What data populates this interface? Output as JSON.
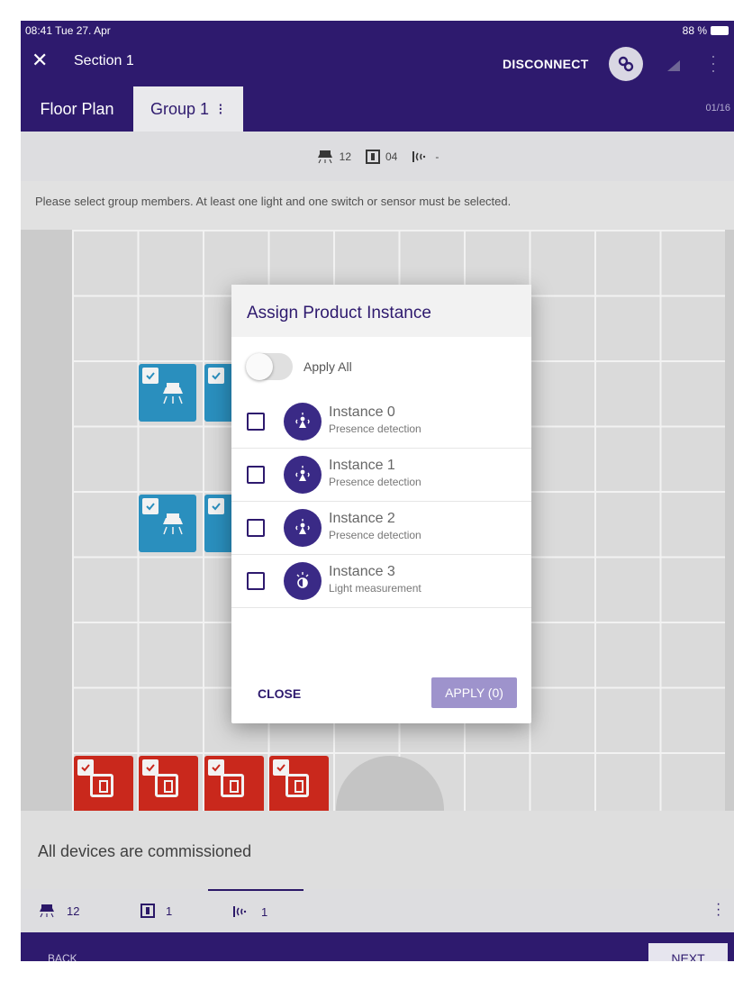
{
  "status_bar": {
    "time": "08:41  Tue 27. Apr",
    "battery": "88 %"
  },
  "app_bar": {
    "close_glyph": "✕",
    "title": "Section 1",
    "disconnect_label": "DISCONNECT",
    "link_icon": "link-icon",
    "signal_icon": "signal-icon"
  },
  "tabs": {
    "floor_plan": "Floor Plan",
    "group": "Group 1",
    "pager": "01/16"
  },
  "counts": {
    "lights": "12",
    "switches": "04",
    "sensors": "-"
  },
  "instruction": "Please select group members. At least one light and one switch or sensor must be selected.",
  "status_message": "All devices are commissioned",
  "bottom_tabs": {
    "lights": "12",
    "switches": "1",
    "sensors": "1"
  },
  "footer": {
    "back": "BACK",
    "next": "NEXT"
  },
  "dialog": {
    "title": "Assign Product Instance",
    "apply_all_label": "Apply All",
    "instances": [
      {
        "name": "Instance 0",
        "type": "Presence detection",
        "icon": "presence-icon"
      },
      {
        "name": "Instance 1",
        "type": "Presence detection",
        "icon": "presence-icon"
      },
      {
        "name": "Instance 2",
        "type": "Presence detection",
        "icon": "presence-icon"
      },
      {
        "name": "Instance 3",
        "type": "Light measurement",
        "icon": "light-measure-icon"
      }
    ],
    "close_label": "CLOSE",
    "apply_label": "APPLY (0)"
  },
  "colors": {
    "primary": "#2e1a6e",
    "lamp": "#2d97c9",
    "switch": "#d42b1e",
    "apply_disabled": "#9e93cc"
  }
}
